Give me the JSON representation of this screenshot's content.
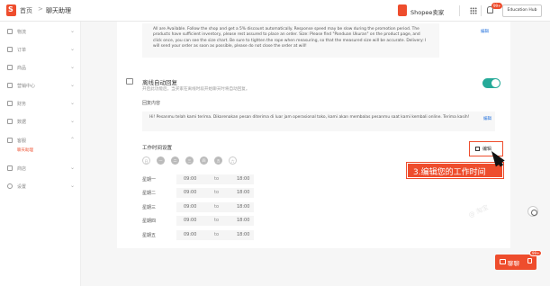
{
  "header": {
    "home": "首页",
    "separator": ">",
    "current": "聊天助理",
    "shop_name": "Shopee卖家",
    "notification_badge": "99+",
    "education_hub": "Education Hub"
  },
  "sidebar": {
    "items": [
      {
        "label": "物流"
      },
      {
        "label": "订单"
      },
      {
        "label": "商品"
      },
      {
        "label": "营销中心"
      },
      {
        "label": "财务"
      },
      {
        "label": "数据"
      },
      {
        "label": "客服",
        "sub": "聊天助理"
      },
      {
        "label": "商店"
      },
      {
        "label": "设置"
      }
    ]
  },
  "top_message": {
    "text": "All are Available. Follow the shop and get a 5% discount automatically. Response speed may be slow during the promotion period. The products have sufficient inventory, please rest assured to place an order. Size: Please find \"Panduan Ukuran\" on the product page, and click once, you can see the size chart. Be sure to tighten the rope when measuring, so that the measured size will be accurate. Delivery: I will send your order as soon as possible, please do not close the order at will!",
    "edit": "编辑"
  },
  "offline_reply": {
    "title": "离线自动回复",
    "description": "开启此功能后，当买家在离线时段开始聊天时将自动回复。",
    "reply_label": "回复内容",
    "reply_text": "Hi! Pesanmu telah kami terima. Dikarenakan pesan diterima di luar jam operasional toko, kami akan membalas pesanmu saat kami kembali online. Terima kasih!",
    "edit": "编辑"
  },
  "working_hours": {
    "label": "工作时间设置",
    "edit": "编辑",
    "days": [
      {
        "label": "日",
        "on": false
      },
      {
        "label": "一",
        "on": true
      },
      {
        "label": "二",
        "on": true
      },
      {
        "label": "三",
        "on": true
      },
      {
        "label": "四",
        "on": true
      },
      {
        "label": "五",
        "on": true
      },
      {
        "label": "六",
        "on": false
      }
    ],
    "schedule": [
      {
        "day": "星期一",
        "from": "09:00",
        "to": "to",
        "until": "18:00"
      },
      {
        "day": "星期二",
        "from": "09:00",
        "to": "to",
        "until": "18:00"
      },
      {
        "day": "星期三",
        "from": "09:00",
        "to": "to",
        "until": "18:00"
      },
      {
        "day": "星期四",
        "from": "09:00",
        "to": "to",
        "until": "18:00"
      },
      {
        "day": "星期五",
        "from": "09:00",
        "to": "to",
        "until": "18:00"
      }
    ]
  },
  "callout": "3.编辑您的工作时间",
  "chat": {
    "label": "聊聊",
    "badge": "99+"
  },
  "watermark": "@ 淘宝"
}
